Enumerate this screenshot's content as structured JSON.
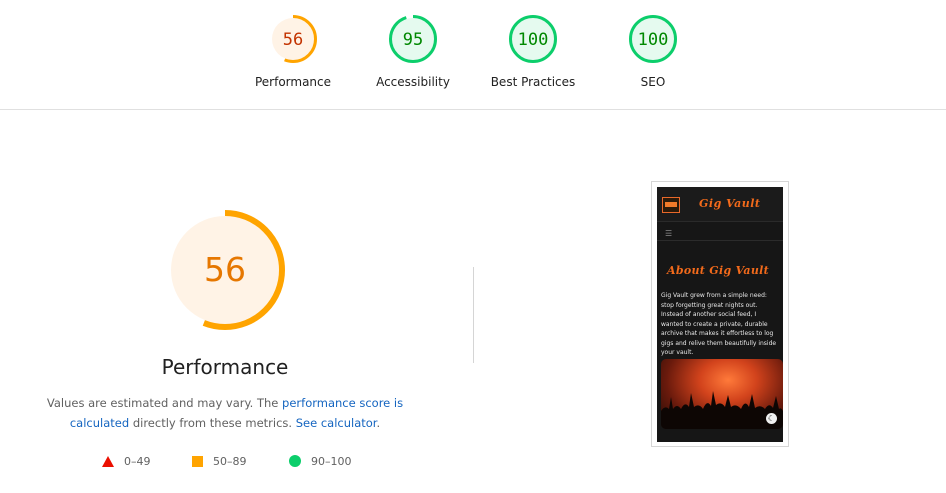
{
  "categories": [
    {
      "label": "Performance",
      "score": "56",
      "value": 0.56,
      "ring": "#ffa400",
      "fill": "#fff3e6",
      "text": "#c33300"
    },
    {
      "label": "Accessibility",
      "score": "95",
      "value": 0.95,
      "ring": "#0cce6b",
      "fill": "#e5faef",
      "text": "#008800"
    },
    {
      "label": "Best Practices",
      "score": "100",
      "value": 1.0,
      "ring": "#0cce6b",
      "fill": "#e5faef",
      "text": "#008800"
    },
    {
      "label": "SEO",
      "score": "100",
      "value": 1.0,
      "ring": "#0cce6b",
      "fill": "#e5faef",
      "text": "#008800"
    }
  ],
  "main": {
    "title": "Performance",
    "score": "56",
    "value": 0.56,
    "ring": "#ffa400",
    "fill": "#fff3e6",
    "text_color": "#e67700",
    "desc_prefix": "Values are estimated and may vary. The ",
    "desc_link1": "performance score is calculated",
    "desc_middle": " directly from these metrics. ",
    "desc_link2": "See calculator",
    "desc_suffix": "."
  },
  "legend": [
    {
      "range": "0–49",
      "icon": "fail-triangle-icon",
      "color": "#eb0f00"
    },
    {
      "range": "50–89",
      "icon": "average-square-icon",
      "color": "#ffa400"
    },
    {
      "range": "90–100",
      "icon": "pass-circle-icon",
      "color": "#0cce6b"
    }
  ],
  "screenshot": {
    "brand": "Gig Vault",
    "menu_icon": "hamburger-icon",
    "heading": "About Gig Vault",
    "body": "Gig Vault grew from a simple need: stop forgetting great nights out. Instead of another social feed, I wanted to create a private, durable archive that makes it effortless to log gigs and relive them beautifully inside your vault.",
    "theme_icon": "moon-icon"
  }
}
